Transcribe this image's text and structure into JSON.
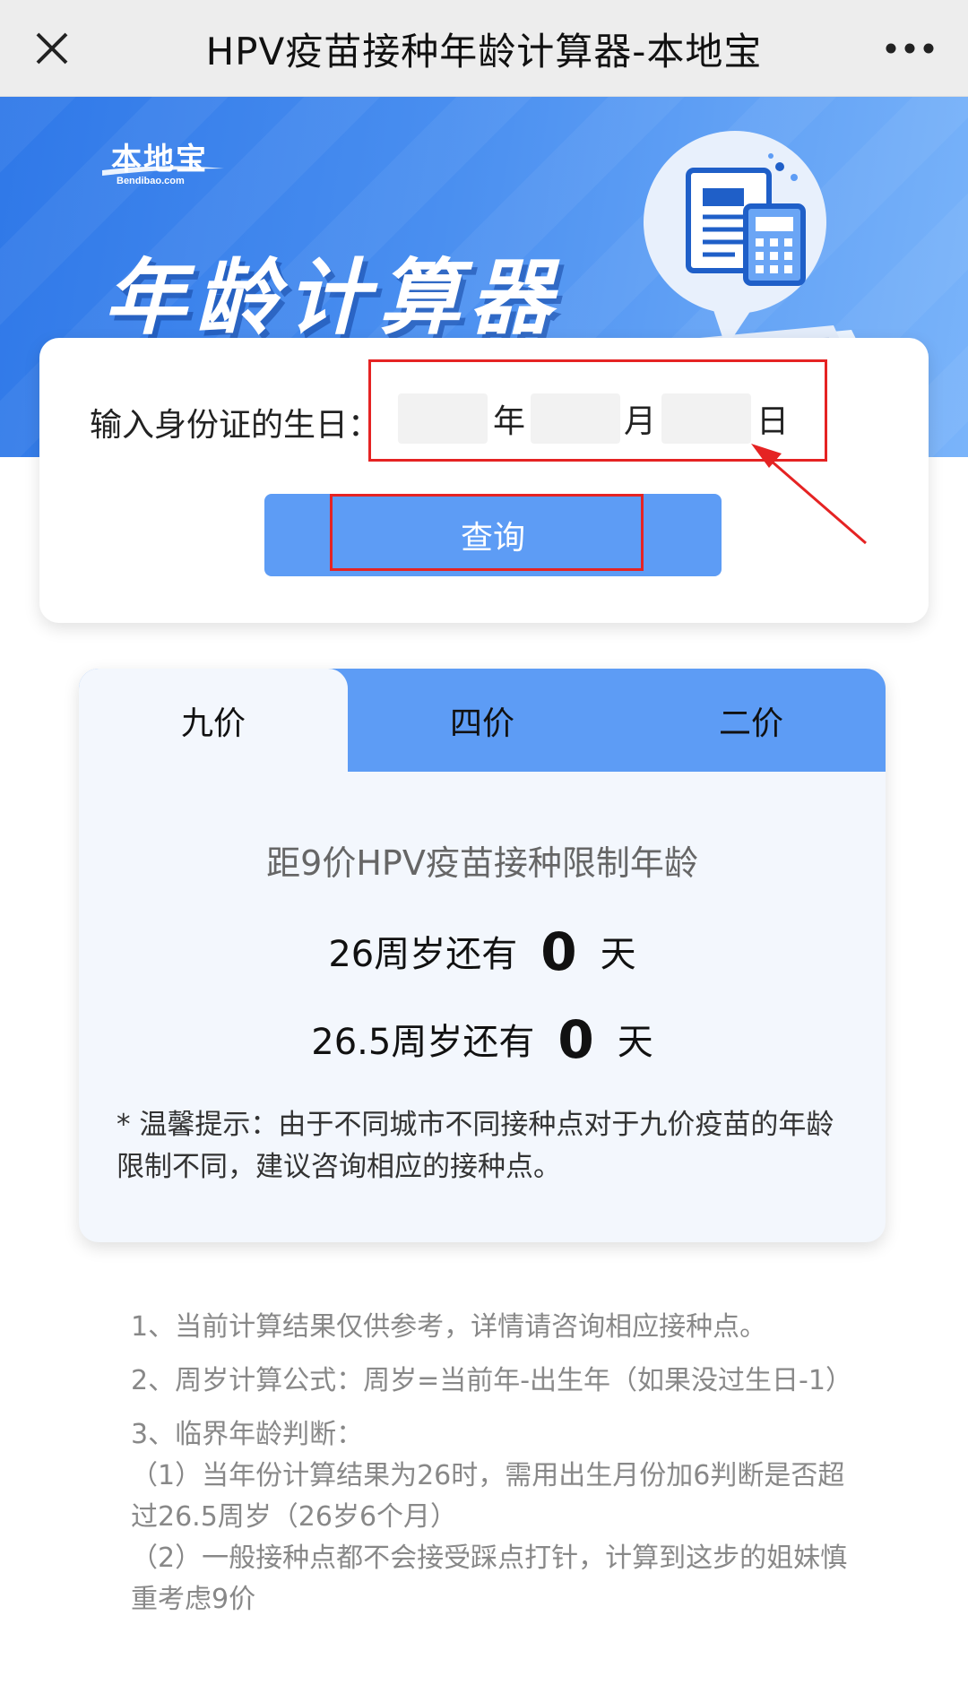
{
  "topbar": {
    "title": "HPV疫苗接种年龄计算器-本地宝"
  },
  "banner": {
    "logo_main": "本地宝",
    "logo_sub": "Bendibao.com",
    "title": "年龄计算器"
  },
  "input_card": {
    "label": "输入身份证的生日：",
    "year_value": "",
    "month_value": "",
    "day_value": "",
    "year_unit": "年",
    "month_unit": "月",
    "day_unit": "日",
    "query_label": "查询"
  },
  "result_card": {
    "tabs": [
      {
        "label": "九价",
        "active": true
      },
      {
        "label": "四价",
        "active": false
      },
      {
        "label": "二价",
        "active": false
      }
    ],
    "heading": "距9价HPV疫苗接种限制年龄",
    "row1_prefix": "26周岁还有",
    "row1_value": "0",
    "row1_suffix": "天",
    "row2_prefix": "26.5周岁还有",
    "row2_value": "0",
    "row2_suffix": "天",
    "tip": "* 温馨提示：由于不同城市不同接种点对于九价疫苗的年龄限制不同，建议咨询相应的接种点。"
  },
  "notes": [
    "1、当前计算结果仅供参考，详情请咨询相应接种点。",
    "2、周岁计算公式：周岁=当前年-出生年（如果没过生日-1）",
    "3、临界年龄判断：",
    "（1）当年份计算结果为26时，需用出生月份加6判断是否超过26.5周岁（26岁6个月）",
    "（2）一般接种点都不会接受踩点打针，计算到这步的姐妹慎重考虑9价"
  ],
  "colors": {
    "accent": "#5d9cf5",
    "banner_start": "#2f78e8",
    "highlight": "#e52323",
    "card_bg": "#f3f7fd"
  },
  "icons": [
    "close-icon",
    "more-dots-icon",
    "calculator-document-icon"
  ]
}
